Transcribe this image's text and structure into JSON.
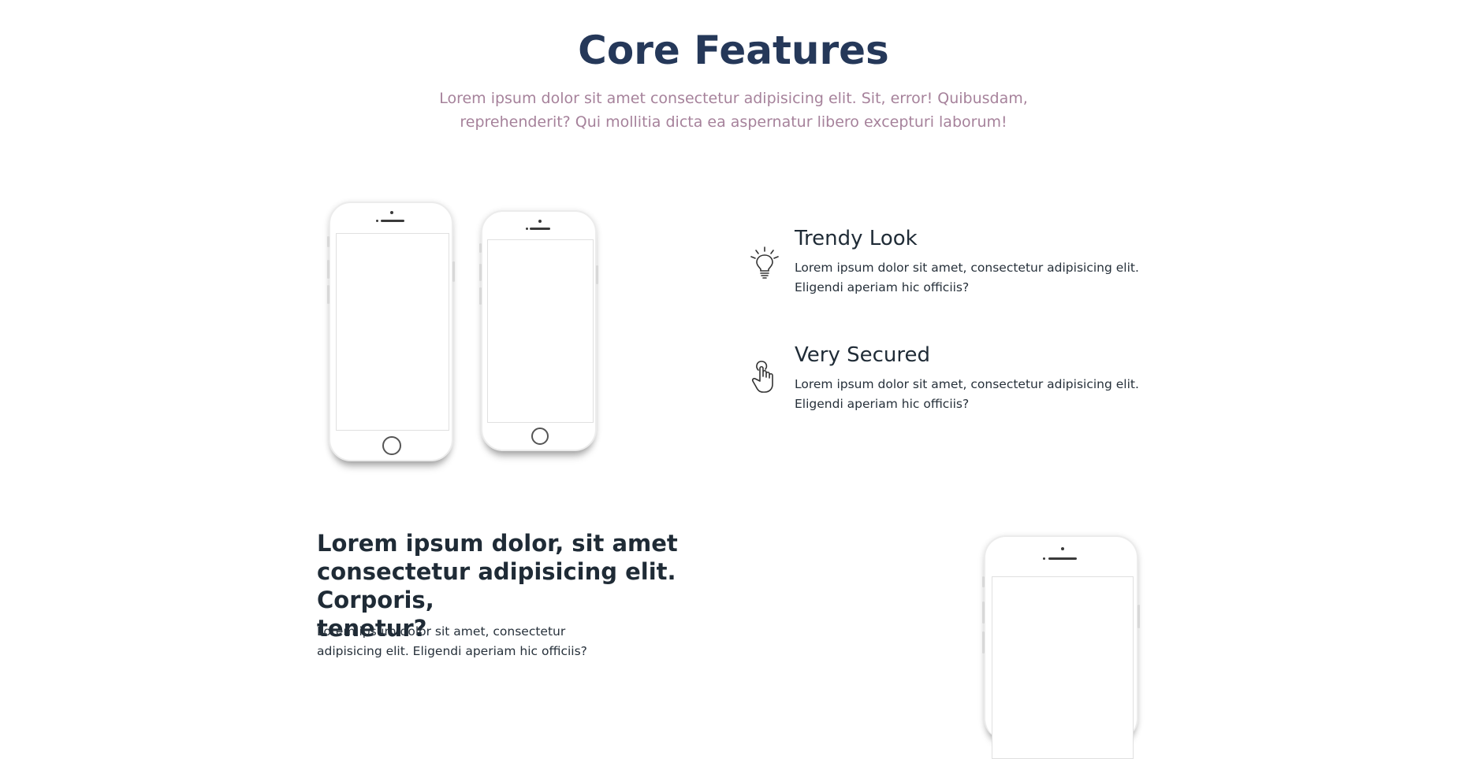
{
  "header": {
    "title": "Core Features",
    "subtitle_line1": "Lorem ipsum dolor sit amet consectetur adipisicing elit. Sit, error! Quibusdam,",
    "subtitle_line2": "reprehenderit? Qui mollitia dicta ea aspernatur libero excepturi laborum!"
  },
  "features": [
    {
      "icon": "lightbulb-icon",
      "title": "Trendy Look",
      "text_line1": "Lorem ipsum dolor sit amet, consectetur adipisicing elit.",
      "text_line2": "Eligendi aperiam hic officiis?"
    },
    {
      "icon": "pointer-hand-icon",
      "title": "Very Secured",
      "text_line1": "Lorem ipsum dolor sit amet, consectetur adipisicing elit.",
      "text_line2": "Eligendi aperiam hic officiis?"
    }
  ],
  "lower_section": {
    "heading_line1": "Lorem ipsum dolor, sit amet",
    "heading_line2": "consectetur adipisicing elit. Corporis,",
    "heading_line3": "tenetur?",
    "text_line1": "Lorem ipsum dolor sit amet, consectetur",
    "text_line2": "adipisicing elit. Eligendi aperiam hic officiis?"
  },
  "colors": {
    "title": "#253859",
    "subtitle": "#a6829b",
    "body_text": "#26303a",
    "background": "#ffffff"
  }
}
